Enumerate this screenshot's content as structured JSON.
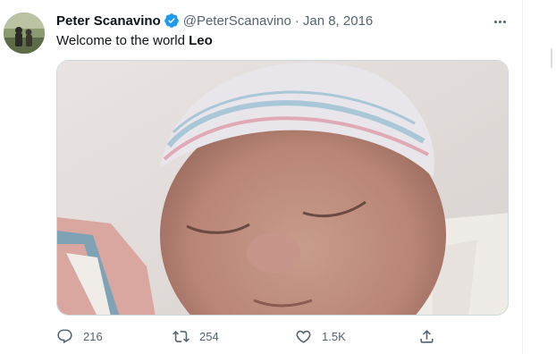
{
  "tweet": {
    "author_name": "Peter Scanavino",
    "handle": "@PeterScanavino",
    "separator": "·",
    "date": "Jan 8, 2016",
    "text_prefix": "Welcome to the world ",
    "text_bold": "Leo",
    "verified": true
  },
  "actions": {
    "reply_count": "216",
    "retweet_count": "254",
    "like_count": "1.5K"
  },
  "colors": {
    "verified_blue": "#1d9bf0",
    "secondary_text": "#536471",
    "primary_text": "#0f1419"
  },
  "icons": [
    "verified-badge-icon",
    "more-options-icon",
    "reply-icon",
    "retweet-icon",
    "like-icon",
    "share-icon"
  ]
}
